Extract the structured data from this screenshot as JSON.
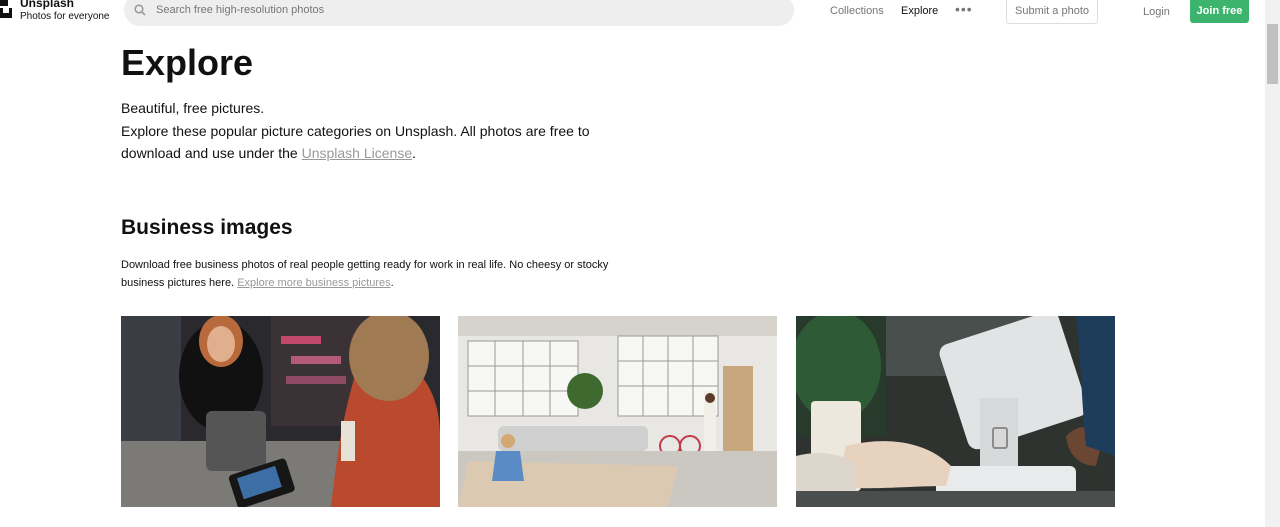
{
  "brand": {
    "name": "Unsplash",
    "tagline": "Photos for everyone"
  },
  "search": {
    "placeholder": "Search free high-resolution photos",
    "value": ""
  },
  "nav": {
    "collections": "Collections",
    "explore": "Explore",
    "more": "•••",
    "submit": "Submit a photo",
    "login": "Login",
    "join": "Join free"
  },
  "page": {
    "title": "Explore",
    "intro_line1": "Beautiful, free pictures.",
    "intro_line2": "Explore these popular picture categories on Unsplash. All photos are free to download and use under the",
    "license_link": "Unsplash License",
    "intro_end": "."
  },
  "section": {
    "title": "Business images",
    "desc": "Download free business photos of real people getting ready for work in real life. No cheesy or stocky business pictures here.",
    "link": "Explore more business pictures",
    "desc_end": "."
  },
  "photos": [
    {
      "subject": "payment at shop counter"
    },
    {
      "subject": "bright open office"
    },
    {
      "subject": "tablet point of sale"
    }
  ],
  "colors": {
    "accent": "#3cb46e",
    "link": "#999999",
    "muted": "#767676"
  }
}
